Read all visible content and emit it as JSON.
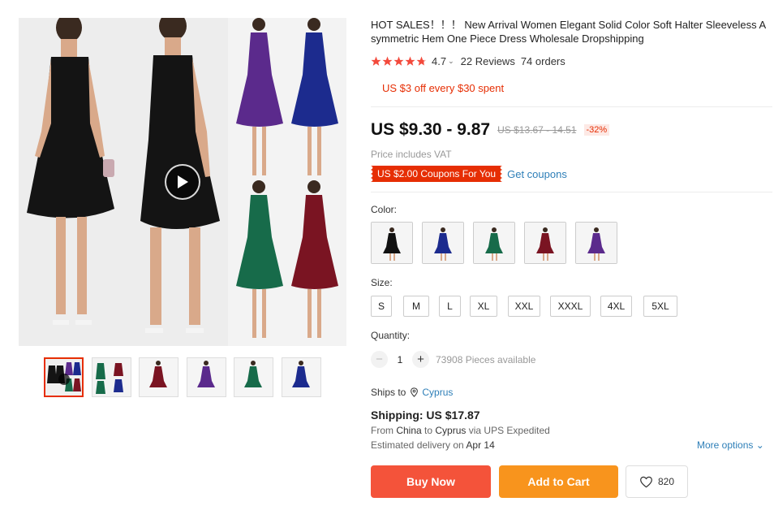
{
  "gallery": {
    "main_image_alt": "",
    "play_icon": "play-icon",
    "thumbnail_count": 6,
    "active_thumbnail": 0,
    "dress_colors": [
      "#111111",
      "#1c2b8e",
      "#176b4a",
      "#7a1422",
      "#5b2a8c"
    ]
  },
  "product": {
    "title": "HOT SALES！！！ New Arrival Women Elegant Solid Color Soft Halter Sleeveless Asymmetric Hem One Piece Dress Wholesale Dropshipping",
    "rating": "4.7",
    "rating_stars": 4.7,
    "reviews": "22 Reviews",
    "orders": "74 orders",
    "promo": "US $3 off every $30 spent",
    "price": "US $9.30 - 9.87",
    "original_price": "US $13.67 - 14.51",
    "discount": "-32%",
    "vat_note": "Price includes VAT",
    "coupon_tag": "US $2.00 Coupons For You",
    "get_coupons": "Get coupons"
  },
  "color": {
    "label": "Color:",
    "options": [
      "#111111",
      "#1c2b8e",
      "#176b4a",
      "#7a1422",
      "#5b2a8c"
    ]
  },
  "size": {
    "label": "Size:",
    "options": [
      "S",
      "M",
      "L",
      "XL",
      "XXL",
      "XXXL",
      "4XL",
      "5XL"
    ]
  },
  "quantity": {
    "label": "Quantity:",
    "minus": "−",
    "value": "1",
    "plus": "+",
    "available": "73908 Pieces available"
  },
  "shipping": {
    "ships_to_label": "Ships to",
    "destination": "Cyprus",
    "cost": "Shipping: US $17.87",
    "from_prefix": "From ",
    "from_country": "China",
    "to_word": " to ",
    "to_country": "Cyprus",
    "via": " via UPS Expedited",
    "delivery_prefix": "Estimated delivery on ",
    "delivery_date": "Apr 14",
    "more_options": "More options"
  },
  "actions": {
    "buy_now": "Buy Now",
    "add_to_cart": "Add to Cart",
    "wishlist_count": "820"
  },
  "colors": {
    "accent_red": "#e62e04",
    "buy_now_bg": "#f4533a",
    "add_cart_bg": "#f8941d",
    "link_blue": "#2e7fb8",
    "star": "#f34a3c"
  }
}
